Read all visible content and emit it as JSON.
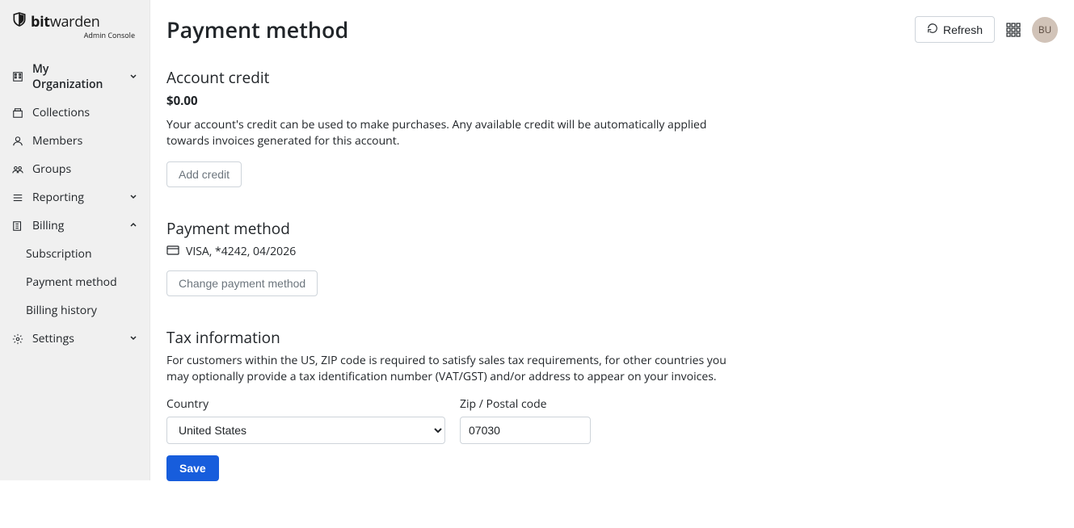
{
  "brand": {
    "name_bold": "bit",
    "name_light": "warden",
    "subtitle": "Admin Console"
  },
  "sidebar": {
    "items": [
      {
        "label": "My Organization",
        "icon": "building",
        "expandable": true,
        "open": false,
        "bold": true
      },
      {
        "label": "Collections",
        "icon": "box"
      },
      {
        "label": "Members",
        "icon": "user"
      },
      {
        "label": "Groups",
        "icon": "group"
      },
      {
        "label": "Reporting",
        "icon": "report",
        "expandable": true,
        "open": false
      },
      {
        "label": "Billing",
        "icon": "billing",
        "expandable": true,
        "open": true,
        "children": [
          {
            "label": "Subscription",
            "active": false
          },
          {
            "label": "Payment method",
            "active": true
          },
          {
            "label": "Billing history",
            "active": false
          }
        ]
      },
      {
        "label": "Settings",
        "icon": "gear",
        "expandable": true,
        "open": false
      }
    ]
  },
  "header": {
    "title": "Payment method",
    "refresh_label": "Refresh",
    "avatar_initials": "BU"
  },
  "account_credit": {
    "heading": "Account credit",
    "amount": "$0.00",
    "description": "Your account's credit can be used to make purchases. Any available credit will be automatically applied towards invoices generated for this account.",
    "add_button": "Add credit"
  },
  "payment_method": {
    "heading": "Payment method",
    "card_text": "VISA, *4242, 04/2026",
    "change_button": "Change payment method"
  },
  "tax": {
    "heading": "Tax information",
    "description": "For customers within the US, ZIP code is required to satisfy sales tax requirements, for other countries you may optionally provide a tax identification number (VAT/GST) and/or address to appear on your invoices.",
    "country_label": "Country",
    "country_value": "United States",
    "zip_label": "Zip / Postal code",
    "zip_value": "07030",
    "save_button": "Save"
  }
}
